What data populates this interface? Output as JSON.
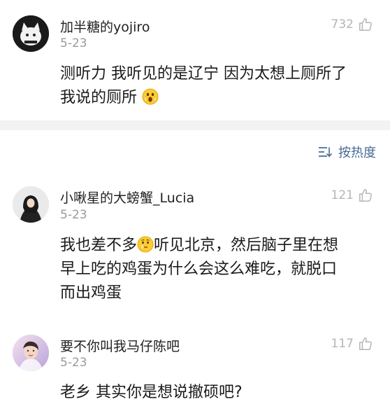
{
  "top_comment": {
    "username": "加半糖的yojiro",
    "date": "5-23",
    "likes": "732",
    "text_line1": "测听力 我听见的是辽宁 因为太想上厕所了",
    "text_line2": "我说的厕所",
    "emoji": "scream-face-icon"
  },
  "sort": {
    "label": "按热度",
    "icon": "sort-icon"
  },
  "comments": [
    {
      "username": "小啾星的大螃蟹_Lucia",
      "date": "5-23",
      "likes": "121",
      "text_part1": "我也差不多",
      "text_part2": "听见北京，然后脑子里在想",
      "text_line2": "早上吃的鸡蛋为什么会这么难吃，就脱口",
      "text_line3": "而出鸡蛋",
      "emoji": "thinking-face-icon"
    },
    {
      "username": "要不你叫我马仔陈吧",
      "date": "5-23",
      "likes": "117",
      "text_line1": "老乡 其实你是想说撤硕吧?"
    }
  ],
  "colors": {
    "accent_link": "#4a6a96",
    "muted": "#9a9a9a",
    "divider": "#f2f2f2"
  }
}
